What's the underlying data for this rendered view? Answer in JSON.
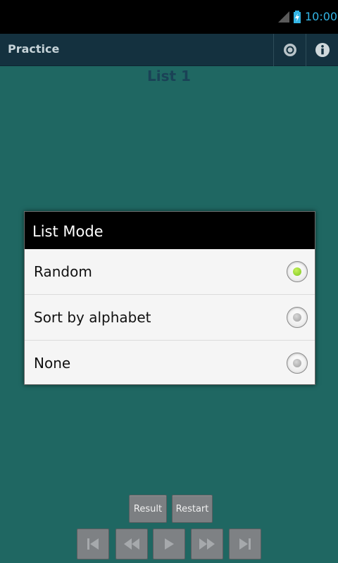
{
  "status_bar": {
    "time": "10:00",
    "accent_color": "#33b5e5"
  },
  "action_bar": {
    "title": "Practice",
    "icons": [
      "settings-icon",
      "info-icon"
    ]
  },
  "content": {
    "list_title": "List 1"
  },
  "dialog": {
    "title": "List Mode",
    "options": [
      {
        "label": "Random",
        "selected": true
      },
      {
        "label": "Sort by alphabet",
        "selected": false
      },
      {
        "label": "None",
        "selected": false
      }
    ],
    "selected_color": "#8ed22f"
  },
  "bottom": {
    "result_label": "Result",
    "restart_label": "Restart",
    "media_icons": [
      "skip-first-icon",
      "rewind-icon",
      "play-icon",
      "fast-forward-icon",
      "skip-last-icon"
    ]
  },
  "colors": {
    "background": "#1f6762",
    "action_bar": "#14313f"
  }
}
